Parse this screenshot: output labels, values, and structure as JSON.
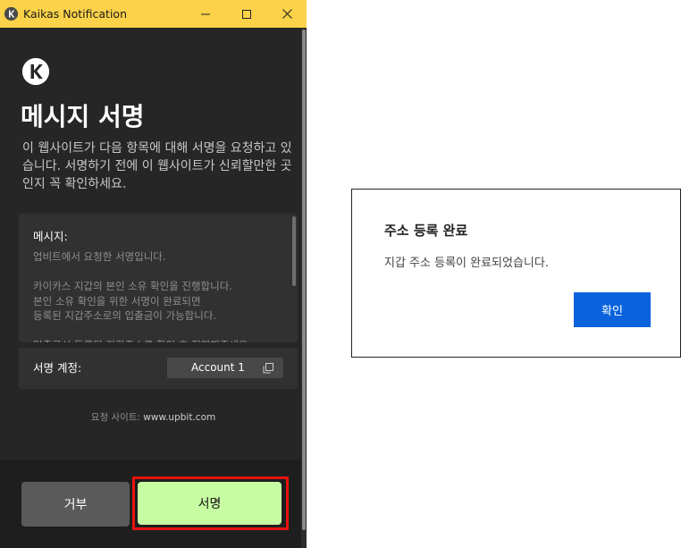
{
  "window": {
    "title": "Kaikas Notification",
    "accent_color": "#fbd249",
    "background_color": "#262626",
    "controls": [
      "minimize-icon",
      "maximize-icon",
      "close-icon"
    ]
  },
  "signature_request": {
    "title": "메시지 서명",
    "description": "이 웹사이트가 다음 항목에 대해 서명을 요청하고 있습니다. 서명하기 전에 이 웹사이트가 신뢰할만한 곳인지 꼭 확인하세요.",
    "message_label": "메시지:",
    "message_content": "업비트에서 요청한 서명입니다.\n\n카이카스 지갑의 본인 소유 확인을 진행합니다.\n본인 소유 확인을 위한 서명이 완료되면\n등록된 지갑주소로의 입출금이 가능합니다.\n\n입출금시 등록된 지갑주소를 확인 후 진행해주세요.",
    "account_label": "서명 계정:",
    "account_name": "Account 1",
    "request_site_label": "요청 사이트: ",
    "request_site_url": "www.upbit.com",
    "reject_label": "거부",
    "sign_label": "서명",
    "sign_button_color": "#c8fca3",
    "highlight_color": "#e5120f"
  },
  "dialog": {
    "title": "주소 등록 완료",
    "message": "지갑 주소 등록이 완료되었습니다.",
    "confirm_label": "확인",
    "confirm_color": "#0a63dd"
  }
}
